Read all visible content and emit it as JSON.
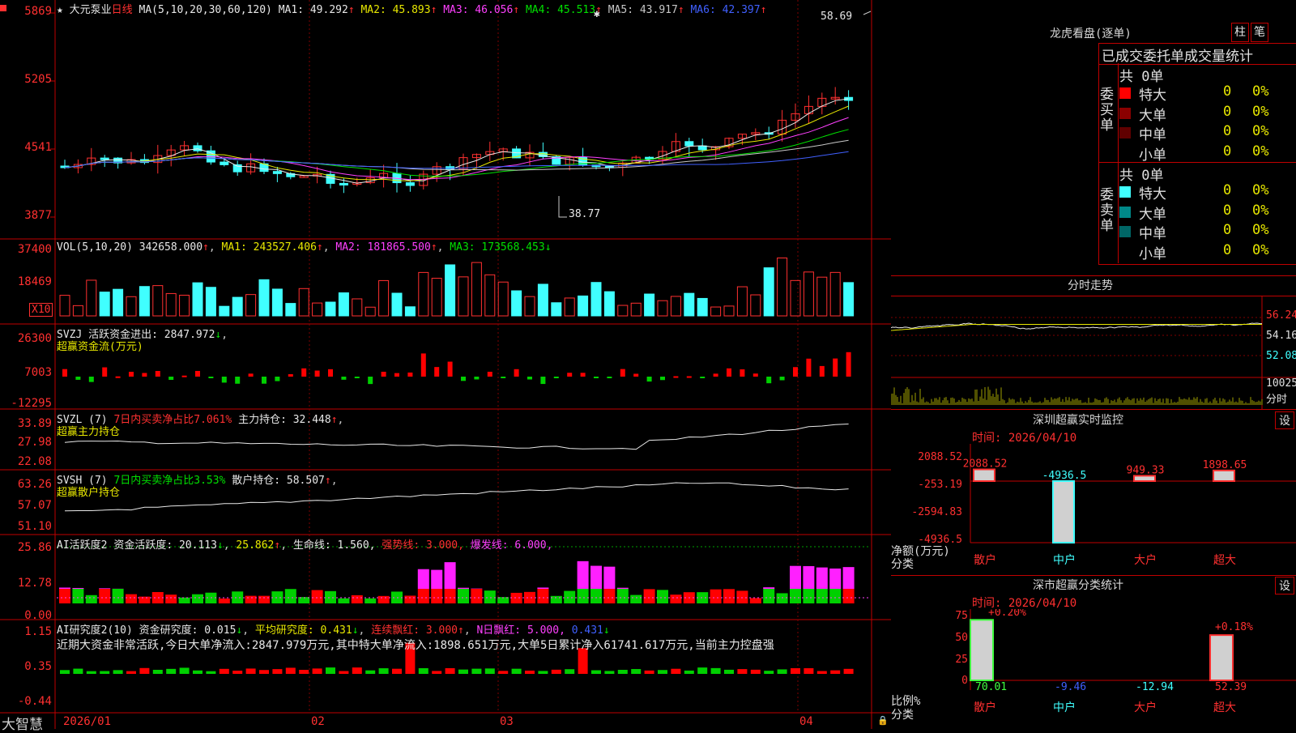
{
  "header": {
    "stock_name": "大元泵业",
    "period": "日线",
    "ma_label": "MA(5,10,20,30,60,120)",
    "ma_values": [
      {
        "name": "MA1:",
        "value": "49.292",
        "color": "#e8e8e8"
      },
      {
        "name": "MA2:",
        "value": "45.893",
        "color": "#e8e800"
      },
      {
        "name": "MA3:",
        "value": "46.056",
        "color": "#ff40ff"
      },
      {
        "name": "MA4:",
        "value": "45.513",
        "color": "#00e000"
      },
      {
        "name": "MA5:",
        "value": "43.917",
        "color": "#c8c8c8"
      },
      {
        "name": "MA6:",
        "value": "42.397",
        "color": "#4060ff"
      }
    ],
    "up_arrow": "↑",
    "down_arrow": "↓"
  },
  "price_axis": [
    "5869",
    "5205",
    "4541",
    "3877"
  ],
  "price_annotations": {
    "high": "58.69",
    "low": "38.77"
  },
  "vol": {
    "axis": [
      "37400",
      "18469"
    ],
    "unit": "X10",
    "label": "VOL(5,10,20)",
    "value": "342658.000",
    "ma1": "MA1: 243527.406",
    "ma2": "MA2: 181865.500",
    "ma3": "MA3: 173568.453"
  },
  "svzj": {
    "axis": [
      "26300",
      "7003",
      "-12295"
    ],
    "label": "SVZJ",
    "desc": "活跃资金进出: 2847.972",
    "title": "超赢资金流(万元)"
  },
  "svzl": {
    "axis": [
      "33.89",
      "27.98",
      "22.08"
    ],
    "label": "SVZL (7)",
    "ratio": "7日内买卖净占比7.061%",
    "hold": "主力持仓: 32.448",
    "title": "超赢主力持仓"
  },
  "svsh": {
    "axis": [
      "63.26",
      "57.07",
      "51.10"
    ],
    "label": "SVSH (7)",
    "ratio": "7日内买卖净占比3.53%",
    "hold": "散户持仓: 58.507",
    "title": "超赢散户持仓"
  },
  "ai_active": {
    "axis": [
      "25.86",
      "12.78",
      "0.00"
    ],
    "label": "AI活跃度2",
    "active": "资金活跃度: 20.113",
    "v2": "25.862",
    "life": "生命线: 1.560,",
    "strong": "强势线: 3.000,",
    "burst": "爆发线: 6.000,"
  },
  "ai_research": {
    "axis": [
      "1.15",
      "0.35",
      "-0.44"
    ],
    "label": "AI研究度2(10)",
    "research": "资金研究度: 0.015",
    "avg": "平均研究度: 0.431",
    "cont": "连续飘红: 3.000",
    "nday": "N日飘红: 5.000,",
    "nval": "0.431",
    "summary": "近期大资金非常活跃,今日大单净流入:2847.979万元,其中特大单净流入:1898.651万元,大单5日累计净入61741.617万元,当前主力控盘强"
  },
  "date_axis": [
    "2026/01",
    "02",
    "03",
    "04"
  ],
  "footer_brand": "大智慧",
  "right": {
    "lhb_title": "龙虎看盘(逐单)",
    "btn_zhu": "柱",
    "btn_bi": "笔",
    "tabs_title": "已成交委托单成交量统计",
    "buy": {
      "side": [
        "委",
        "买",
        "单"
      ],
      "total": "共 0单",
      "rows": [
        {
          "name": "特大",
          "count": "0",
          "pct": "0%",
          "color": "#ff0000"
        },
        {
          "name": "大单",
          "count": "0",
          "pct": "0%",
          "color": "#8a0000"
        },
        {
          "name": "中单",
          "count": "0",
          "pct": "0%",
          "color": "#600000"
        },
        {
          "name": "小单",
          "count": "0",
          "pct": "0%",
          "color": "#000000"
        }
      ]
    },
    "sell": {
      "side": [
        "委",
        "卖",
        "单"
      ],
      "total": "共 0单",
      "rows": [
        {
          "name": "特大",
          "count": "0",
          "pct": "0%",
          "color": "#40ffff"
        },
        {
          "name": "大单",
          "count": "0",
          "pct": "0%",
          "color": "#008888"
        },
        {
          "name": "中单",
          "count": "0",
          "pct": "0%",
          "color": "#006666"
        },
        {
          "name": "小单",
          "count": "0",
          "pct": "0%",
          "color": "#000000"
        }
      ]
    },
    "intraday_title": "分时走势",
    "intraday_axis": [
      "56.24",
      "54.16",
      "52.08",
      "10025",
      "分时"
    ],
    "sz_monitor_title": "深圳超赢实时监控",
    "sz_time": "时间: 2026/04/10",
    "sz_axis": [
      "2088.52",
      "-253.19",
      "-2594.83",
      "-4936.5"
    ],
    "sz_unit": "净额(万元)",
    "sz_cat_label": "分类",
    "sz_bar_values": [
      "2088.52",
      "-4936.5",
      "949.33",
      "1898.65"
    ],
    "sz_categories": [
      "散户",
      "中户",
      "大户",
      "超大"
    ],
    "sz_stat_title": "深市超赢分类统计",
    "sz_stat_time": "时间: 2026/04/10",
    "sz_stat_axis": [
      "75",
      "50",
      "25",
      "0"
    ],
    "sz_stat_unit": "比例%",
    "sz_stat_cat_label": "分类",
    "sz_stat_top": [
      "+0.20%",
      "+0.18%"
    ],
    "sz_stat_values": [
      "70.01",
      "-9.46",
      "-12.94",
      "52.39"
    ],
    "settings_btn": "设"
  }
}
